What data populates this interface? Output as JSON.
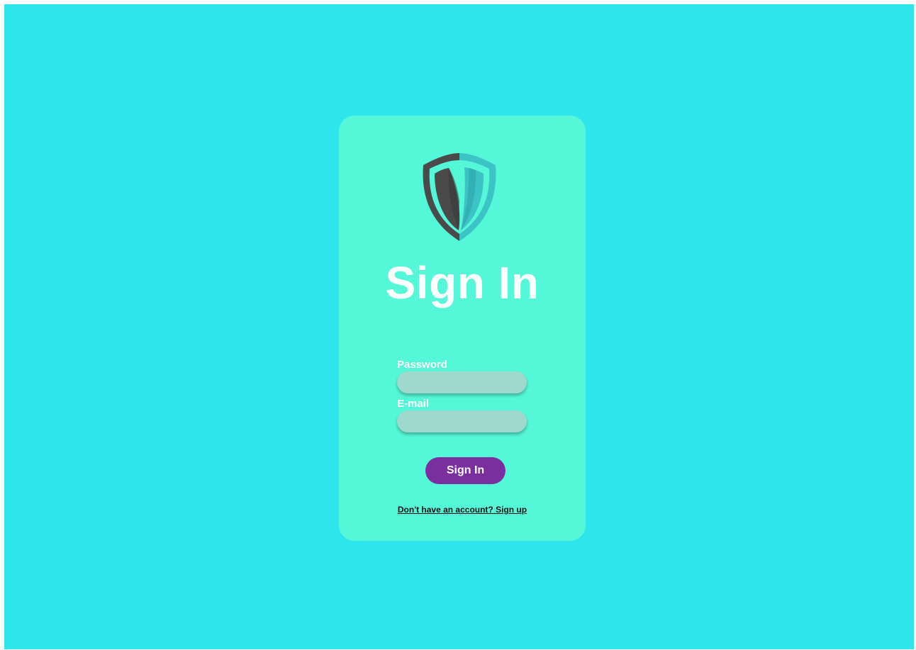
{
  "page": {
    "background_color": "#2ee5ec",
    "card_color": "#54f7d7"
  },
  "logo": {
    "icon": "shield-icon",
    "colors": {
      "dark": "#4a4a4a",
      "teal": "#3cc3c6",
      "inner": "#54f7d7"
    }
  },
  "form": {
    "title": "Sign In",
    "password_label": "Password",
    "password_value": "",
    "email_label": "E-mail",
    "email_value": "",
    "submit_label": "Sign In",
    "submit_color": "#7b2f9f",
    "input_color": "#9fd8cc",
    "signup_text": "Don't have an account? Sign up"
  }
}
